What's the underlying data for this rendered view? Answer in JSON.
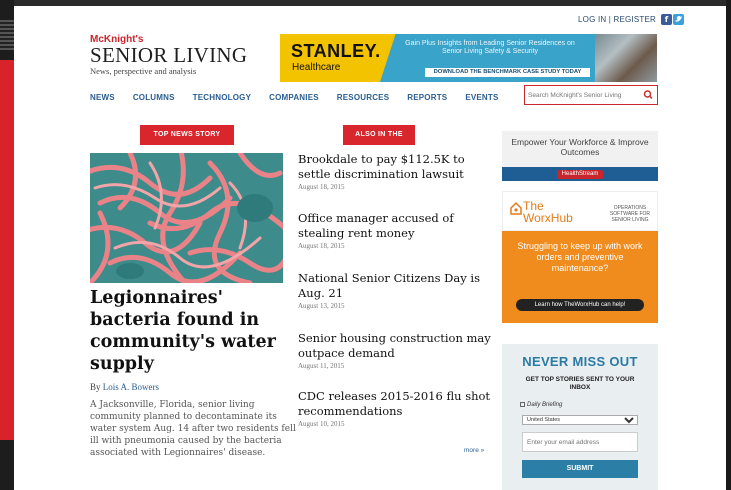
{
  "header": {
    "login": "LOG IN",
    "register": "REGISTER",
    "logo_top": "McKnight's",
    "logo_main": "SENIOR LIVING",
    "logo_sub": "News, perspective and analysis"
  },
  "ad_stanley": {
    "brand": "STANLEY.",
    "sub": "Healthcare",
    "headline": "Gain Plus Insights from Leading Senior Residences on Senior Living Safety & Security",
    "cta": "DOWNLOAD THE BENCHMARK CASE STUDY TODAY"
  },
  "nav": {
    "items": [
      "NEWS",
      "COLUMNS",
      "TECHNOLOGY",
      "COMPANIES",
      "RESOURCES",
      "REPORTS",
      "EVENTS"
    ],
    "search_placeholder": "Search McKnight's Senior Living"
  },
  "top_story": {
    "label": "TOP NEWS STORY",
    "title": "Legionnaires' bacteria found in community's water supply",
    "by": "By",
    "author": "Lois A. Bowers",
    "summary": "A Jacksonville, Florida, senior living community planned to decontaminate its water system Aug. 14 after two residents fell ill with pneumonia caused by the bacteria associated with Legionnaires' disease."
  },
  "also_news": {
    "label": "ALSO IN THE NEWS",
    "items": [
      {
        "title": "Brookdale to pay $112.5K to settle discrimination lawsuit",
        "date": "August 18, 2015"
      },
      {
        "title": "Office manager accused of stealing rent money",
        "date": "August 18, 2015"
      },
      {
        "title": "National Senior Citizens Day is Aug. 21",
        "date": "August 13, 2015"
      },
      {
        "title": "Senior housing construction may outpace demand",
        "date": "August 11, 2015"
      },
      {
        "title": "CDC releases 2015-2016 flu shot recommendations",
        "date": "August 10, 2015"
      }
    ],
    "more": "more »"
  },
  "ad_healthstream": {
    "headline": "Empower Your Workforce & Improve Outcomes",
    "brand": "HealthStream"
  },
  "ad_worxhub": {
    "brand_line1": "The",
    "brand_line2": "WorxHub",
    "tagline": "OPERATIONS SOFTWARE FOR SENIOR LIVING",
    "message": "Struggling to keep up with work orders and preventive maintenance?",
    "cta": "Learn how TheWorxHub can help!"
  },
  "newsletter": {
    "heading": "NEVER MISS OUT",
    "sub": "GET TOP STORIES SENT TO YOUR INBOX",
    "checkbox_label": "Daily Briefing",
    "country": "United States",
    "email_placeholder": "Enter your email address",
    "submit": "SUBMIT"
  },
  "colors": {
    "brand_red": "#d8262c",
    "nav_blue": "#2a5d92",
    "stanley_yellow": "#f4c300",
    "worx_orange": "#f08c1d",
    "submit_blue": "#2b7fa6",
    "bacteria_pink": "#e98387",
    "bacteria_bg": "#3d8b8a"
  }
}
